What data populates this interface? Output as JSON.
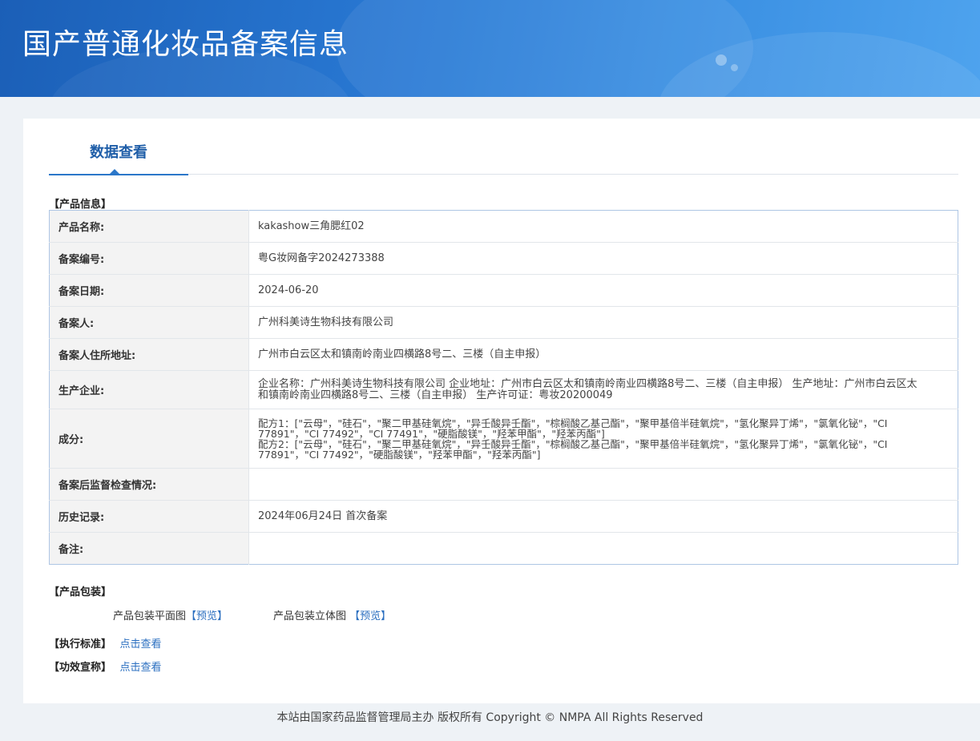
{
  "header": {
    "title": "国产普通化妆品备案信息"
  },
  "tab": {
    "label": "数据查看"
  },
  "product_info": {
    "section_title": "【产品信息】",
    "rows": [
      {
        "label": "产品名称:",
        "value": "kakashow三角腮红02"
      },
      {
        "label": "备案编号:",
        "value": "粤G妆网备字2024273388"
      },
      {
        "label": "备案日期:",
        "value": "2024-06-20"
      },
      {
        "label": "备案人:",
        "value": "广州科美诗生物科技有限公司"
      },
      {
        "label": "备案人住所地址:",
        "value": "广州市白云区太和镇南岭南业四横路8号二、三楼（自主申报）"
      },
      {
        "label": "生产企业:",
        "value": "企业名称：广州科美诗生物科技有限公司 企业地址：广州市白云区太和镇南岭南业四横路8号二、三楼（自主申报） 生产地址：广州市白云区太和镇南岭南业四横路8号二、三楼（自主申报） 生产许可证：粤妆20200049"
      },
      {
        "label": "成分:",
        "value": "配方1：[\"云母\"，\"硅石\"，\"聚二甲基硅氧烷\"，\"异壬酸异壬酯\"，\"棕榈酸乙基己酯\"，\"聚甲基倍半硅氧烷\"，\"氢化聚异丁烯\"，\"氯氧化铋\"，\"CI 77891\"，\"CI 77492\"，\"CI 77491\"，\"硬脂酸镁\"，\"羟苯甲酯\"，\"羟苯丙酯\"]\n配方2：[\"云母\"，\"硅石\"，\"聚二甲基硅氧烷\"，\"异壬酸异壬酯\"，\"棕榈酸乙基己酯\"，\"聚甲基倍半硅氧烷\"，\"氢化聚异丁烯\"，\"氯氧化铋\"，\"CI 77891\"，\"CI 77492\"，\"硬脂酸镁\"，\"羟苯甲酯\"，\"羟苯丙酯\"]"
      },
      {
        "label": "备案后监督检查情况:",
        "value": ""
      },
      {
        "label": "历史记录:",
        "value": "2024年06月24日 首次备案"
      },
      {
        "label": "备注:",
        "value": ""
      }
    ]
  },
  "packaging": {
    "section_title": "【产品包装】",
    "flat_label": "产品包装平面图",
    "flat_link": "【预览】",
    "solid_label": "产品包装立体图",
    "solid_link": "【预览】"
  },
  "standard": {
    "label": "【执行标准】",
    "link": "点击查看"
  },
  "efficacy": {
    "label": "【功效宣称】",
    "link": "点击查看"
  },
  "footer": {
    "text": "本站由国家药品监督管理局主办 版权所有 Copyright © NMPA All Rights Reserved"
  }
}
